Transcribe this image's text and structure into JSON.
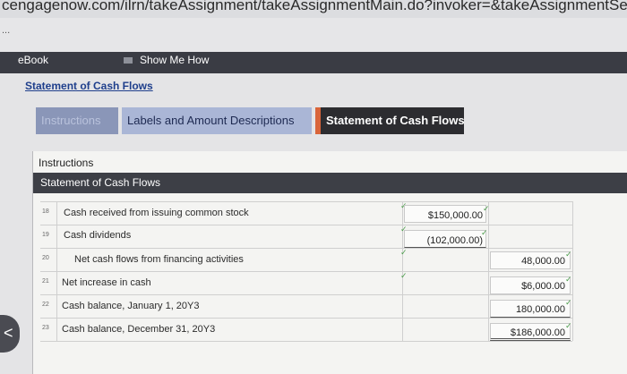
{
  "browser": {
    "url": "cengagenow.com/ilrn/takeAssignment/takeAssignmentMain.do?invoker=&takeAssignmentSessionLocator=&",
    "more": "..."
  },
  "toolbar": {
    "ebook": "eBook",
    "show_me_how": "Show Me How",
    "icon": "video-icon"
  },
  "page": {
    "title": "Statement of Cash Flows"
  },
  "tabs": [
    {
      "label": "Instructions"
    },
    {
      "label": "Labels and Amount Descriptions"
    },
    {
      "label": "Statement of Cash Flows"
    }
  ],
  "panel": {
    "instructions_label": "Instructions",
    "section_title": "Statement of Cash Flows"
  },
  "rows": [
    {
      "num": "18",
      "desc": "Cash received from issuing common stock",
      "amount": "$150,000.00",
      "total": ""
    },
    {
      "num": "19",
      "desc": "Cash dividends",
      "amount": "(102,000.00)",
      "total": ""
    },
    {
      "num": "20",
      "desc": "Net cash flows from financing activities",
      "amount": "",
      "total": "48,000.00"
    },
    {
      "num": "21",
      "desc": "Net increase in cash",
      "amount": "",
      "total": "$6,000.00"
    },
    {
      "num": "22",
      "desc": "Cash balance, January 1, 20Y3",
      "amount": "",
      "total": "180,000.00"
    },
    {
      "num": "23",
      "desc": "Cash balance, December 31, 20Y3",
      "amount": "",
      "total": "$186,000.00"
    }
  ],
  "colors": {
    "accent": "#d9653a",
    "dark": "#3d3f46",
    "check": "#4a9c4a",
    "title_link": "#1f3f8c"
  }
}
